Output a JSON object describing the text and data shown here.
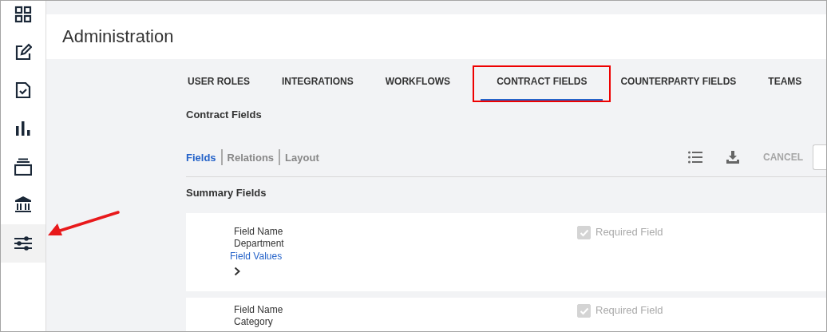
{
  "sidebar": {
    "items": [
      {
        "kind": "grid",
        "selected": false
      },
      {
        "kind": "edit",
        "selected": false
      },
      {
        "kind": "document",
        "selected": false
      },
      {
        "kind": "chart",
        "selected": false
      },
      {
        "kind": "stack",
        "selected": false
      },
      {
        "kind": "bank",
        "selected": false
      },
      {
        "kind": "sliders",
        "selected": true
      }
    ]
  },
  "header": {
    "title": "Administration"
  },
  "tabs": [
    {
      "label": "USER ROLES",
      "selected": false,
      "highlighted": false
    },
    {
      "label": "INTEGRATIONS",
      "selected": false,
      "highlighted": false
    },
    {
      "label": "WORKFLOWS",
      "selected": false,
      "highlighted": false
    },
    {
      "label": "CONTRACT FIELDS",
      "selected": true,
      "highlighted": true
    },
    {
      "label": "COUNTERPARTY FIELDS",
      "selected": false,
      "highlighted": false
    },
    {
      "label": "TEAMS",
      "selected": false,
      "highlighted": false
    }
  ],
  "section_title": "Contract Fields",
  "subtabs": [
    {
      "label": "Fields",
      "selected": true
    },
    {
      "label": "Relations",
      "selected": false
    },
    {
      "label": "Layout",
      "selected": false
    }
  ],
  "toolbar": {
    "cancel": {
      "label": "CANCEL",
      "disabled": true
    }
  },
  "summary_title": "Summary Fields",
  "fields": [
    {
      "label": "Field Name",
      "value": "Department",
      "link": "Field Values",
      "required": {
        "label": "Required Field",
        "checked": true,
        "disabled": true
      }
    },
    {
      "label": "Field Name",
      "value": "Category",
      "required": {
        "label": "Required Field",
        "checked": true,
        "disabled": true
      }
    }
  ]
}
